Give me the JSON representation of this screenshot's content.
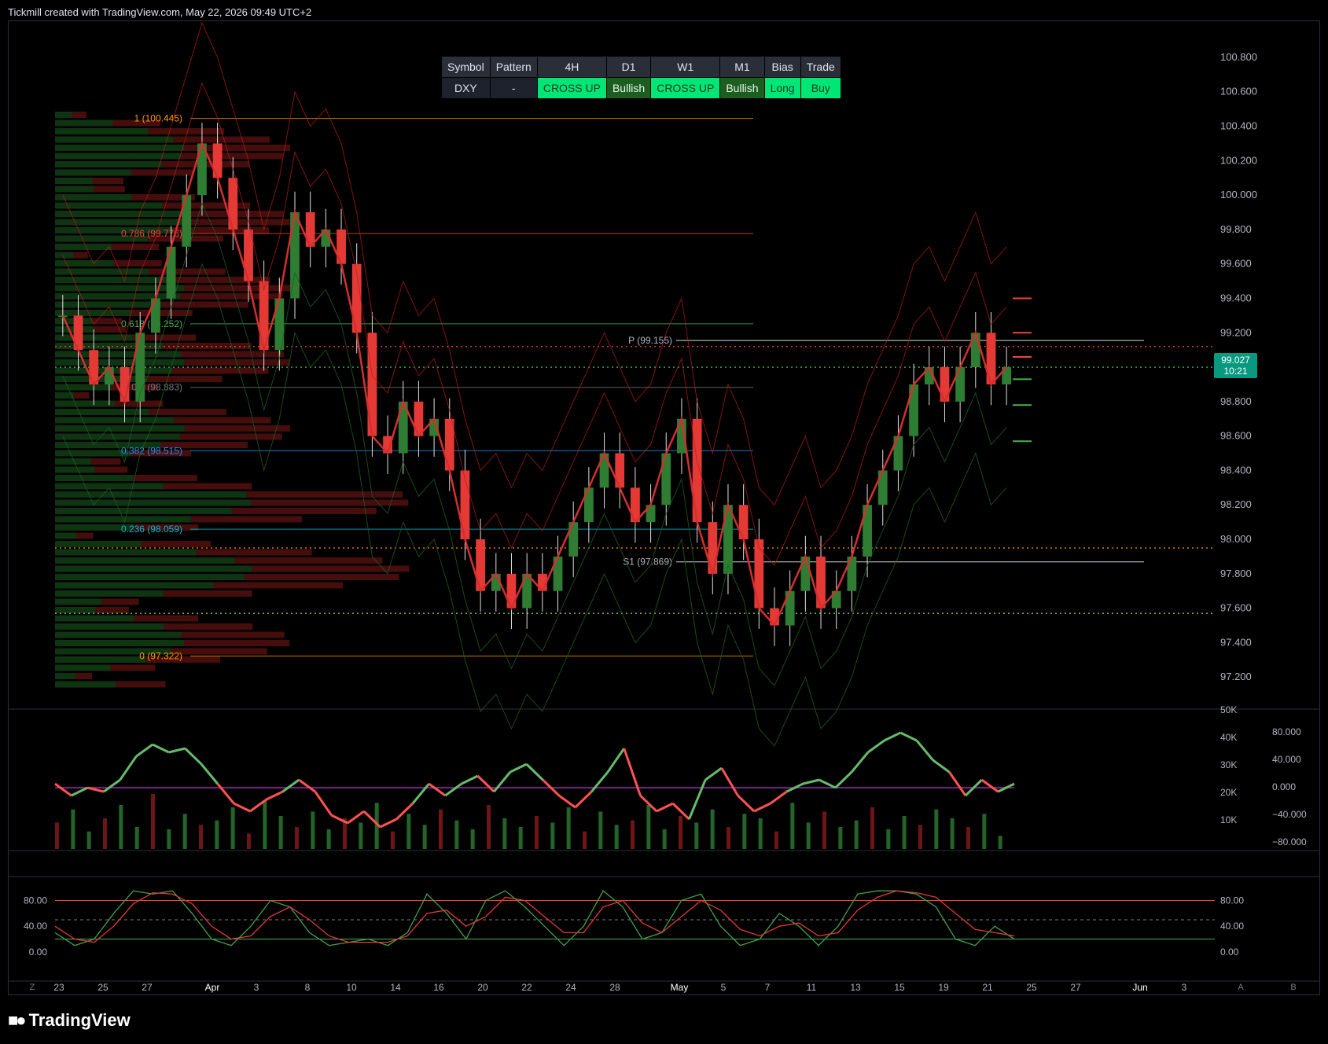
{
  "header": {
    "text": "Tickmill created with TradingView.com, May 22, 2026 09:49 UTC+2"
  },
  "brand": {
    "name": "TradingView"
  },
  "table": {
    "headers": [
      "Symbol",
      "Pattern",
      "4H",
      "D1",
      "W1",
      "M1",
      "Bias",
      "Trade"
    ],
    "values": [
      "DXY",
      "-",
      "CROSS UP",
      "Bullish",
      "CROSS UP",
      "Bullish",
      "Long",
      "Buy"
    ]
  },
  "price_tag": {
    "value": "99.027",
    "countdown": "10:21"
  },
  "axis_buttons": {
    "left": "Z",
    "a": "A",
    "b": "B"
  },
  "colors": {
    "up": "#2e7d32",
    "down": "#e53935",
    "bright_green": "#00e676",
    "fib": "#ff9800",
    "osc_mid": "#9c27b0"
  },
  "chart_data": [
    {
      "type": "candlestick",
      "title": "",
      "y_axis": {
        "ticks": [
          "100.800",
          "100.600",
          "100.400",
          "100.200",
          "100.000",
          "99.800",
          "99.600",
          "99.400",
          "99.200",
          "99.000",
          "98.800",
          "98.600",
          "98.400",
          "98.200",
          "98.000",
          "97.800",
          "97.600",
          "97.400",
          "97.200"
        ],
        "ylim": [
          97.0,
          100.85
        ]
      },
      "x_axis": {
        "ticks": [
          "23",
          "25",
          "27",
          "Apr",
          "3",
          "8",
          "10",
          "14",
          "16",
          "20",
          "22",
          "24",
          "28",
          "May",
          "5",
          "7",
          "11",
          "13",
          "15",
          "19",
          "21",
          "25",
          "27",
          "Jun",
          "3"
        ]
      },
      "fibonacci": [
        {
          "label": "1 (100.445)",
          "value": 100.445
        },
        {
          "label": "0.786 (99.776)",
          "value": 99.776
        },
        {
          "label": "0.618 (99.252)",
          "value": 99.252
        },
        {
          "label": "0.5 (98.883)",
          "value": 98.883
        },
        {
          "label": "0.382 (98.515)",
          "value": 98.515
        },
        {
          "label": "0.236 (98.059)",
          "value": 98.059
        },
        {
          "label": "0 (97.322)",
          "value": 97.322
        }
      ],
      "pivots": [
        {
          "label": "P (99.155)",
          "value": 99.155
        },
        {
          "label": "S1 (97.869)",
          "value": 97.869
        }
      ],
      "close_path": [
        99.3,
        99.1,
        98.9,
        99.0,
        98.8,
        99.2,
        99.4,
        99.7,
        100.0,
        100.3,
        100.1,
        99.8,
        99.5,
        99.1,
        99.4,
        99.9,
        99.7,
        99.8,
        99.6,
        99.2,
        98.6,
        98.5,
        98.8,
        98.6,
        98.7,
        98.4,
        98.0,
        97.7,
        97.8,
        97.6,
        97.8,
        97.7,
        97.9,
        98.1,
        98.3,
        98.5,
        98.3,
        98.1,
        98.2,
        98.5,
        98.7,
        98.1,
        97.8,
        98.2,
        98.0,
        97.6,
        97.5,
        97.7,
        97.9,
        97.6,
        97.7,
        97.9,
        98.2,
        98.4,
        98.6,
        98.9,
        99.0,
        98.8,
        99.0,
        99.2,
        98.9,
        99.0
      ],
      "current_price": 99.027
    },
    {
      "type": "bar+line",
      "title": "",
      "left_axis_ticks": [
        "50K",
        "40K",
        "30K",
        "20K",
        "10K"
      ],
      "right_axis_ticks": [
        "80.000",
        "40.000",
        "0.000",
        "−40.000",
        "−80.000"
      ],
      "osc": [
        5,
        -10,
        0,
        -5,
        10,
        40,
        55,
        45,
        50,
        30,
        5,
        -20,
        -30,
        -15,
        -5,
        10,
        -5,
        -35,
        -45,
        -30,
        -50,
        -40,
        -20,
        5,
        -10,
        5,
        15,
        -5,
        20,
        30,
        10,
        -10,
        -25,
        -5,
        20,
        50,
        -10,
        -30,
        -20,
        -40,
        10,
        25,
        -10,
        -30,
        -20,
        -5,
        5,
        10,
        0,
        20,
        45,
        60,
        70,
        60,
        35,
        20,
        -10,
        10,
        -5,
        5
      ],
      "volume": [
        12,
        18,
        8,
        14,
        20,
        10,
        25,
        9,
        16,
        11,
        13,
        19,
        7,
        22,
        15,
        10,
        17,
        9,
        14,
        12,
        21,
        8,
        16,
        11,
        18,
        13,
        9,
        20,
        14,
        10,
        15,
        12,
        19,
        8,
        17,
        11,
        13,
        20,
        9,
        15,
        12,
        18,
        10,
        16,
        14,
        8,
        21,
        12,
        17,
        10,
        13,
        19,
        9,
        15,
        11,
        18,
        14,
        10,
        16,
        6
      ]
    },
    {
      "type": "line",
      "title": "",
      "y_axis": {
        "ticks": [
          "80.00",
          "40.00",
          "0.00"
        ],
        "ylim": [
          -5,
          105
        ]
      },
      "k": [
        30,
        10,
        20,
        60,
        95,
        90,
        95,
        60,
        20,
        10,
        40,
        80,
        70,
        30,
        10,
        15,
        20,
        10,
        30,
        90,
        60,
        20,
        80,
        95,
        70,
        40,
        10,
        40,
        95,
        70,
        20,
        30,
        80,
        90,
        40,
        10,
        20,
        60,
        40,
        10,
        40,
        90,
        95,
        95,
        90,
        70,
        20,
        10,
        40,
        20
      ],
      "d": [
        40,
        20,
        15,
        40,
        75,
        92,
        90,
        75,
        40,
        20,
        25,
        55,
        70,
        50,
        25,
        15,
        15,
        15,
        25,
        60,
        65,
        40,
        55,
        85,
        80,
        55,
        30,
        30,
        70,
        80,
        45,
        30,
        55,
        80,
        65,
        35,
        25,
        40,
        45,
        25,
        30,
        65,
        85,
        95,
        92,
        85,
        60,
        35,
        30,
        25
      ]
    }
  ]
}
